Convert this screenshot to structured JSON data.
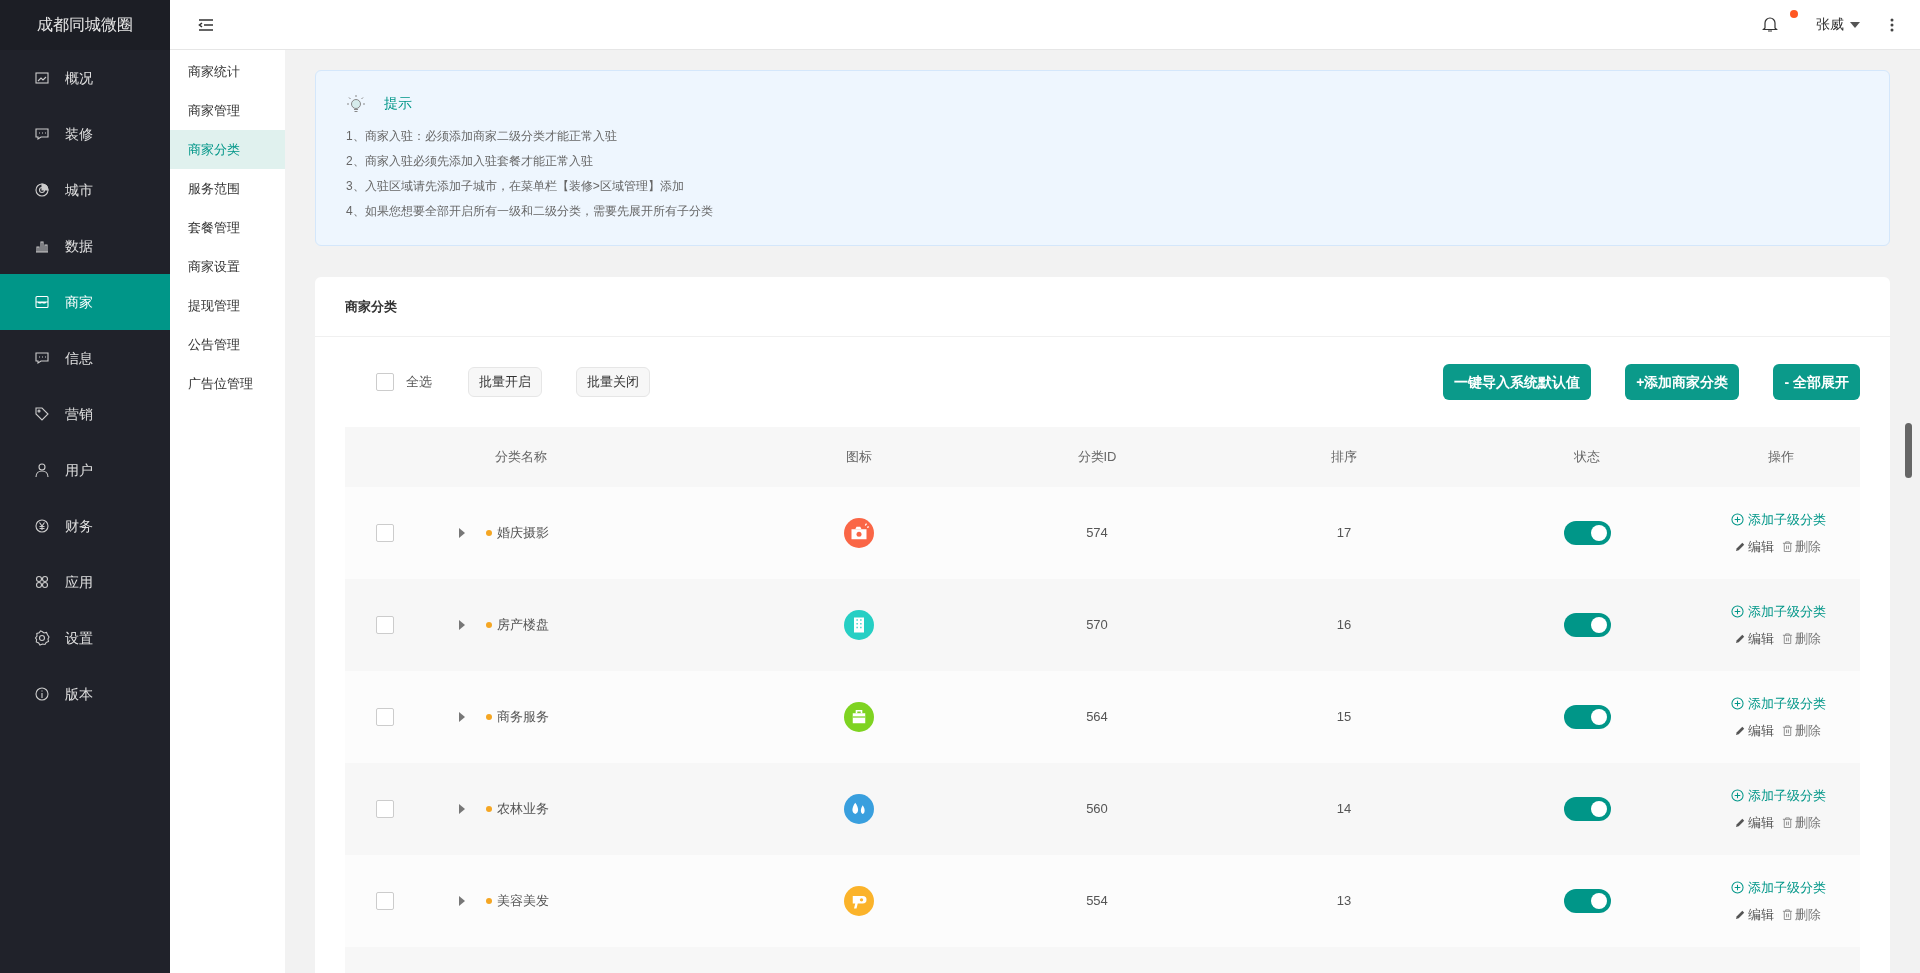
{
  "app_title": "成都同城微圈",
  "sidebar": {
    "items": [
      {
        "label": "概况",
        "selected": false
      },
      {
        "label": "装修",
        "selected": false
      },
      {
        "label": "城市",
        "selected": false
      },
      {
        "label": "数据",
        "selected": false
      },
      {
        "label": "商家",
        "selected": true
      },
      {
        "label": "信息",
        "selected": false
      },
      {
        "label": "营销",
        "selected": false
      },
      {
        "label": "用户",
        "selected": false
      },
      {
        "label": "财务",
        "selected": false
      },
      {
        "label": "应用",
        "selected": false
      },
      {
        "label": "设置",
        "selected": false
      },
      {
        "label": "版本",
        "selected": false
      }
    ]
  },
  "submenu": {
    "items": [
      {
        "label": "商家统计",
        "selected": false
      },
      {
        "label": "商家管理",
        "selected": false
      },
      {
        "label": "商家分类",
        "selected": true
      },
      {
        "label": "服务范围",
        "selected": false
      },
      {
        "label": "套餐管理",
        "selected": false
      },
      {
        "label": "商家设置",
        "selected": false
      },
      {
        "label": "提现管理",
        "selected": false
      },
      {
        "label": "公告管理",
        "selected": false
      },
      {
        "label": "广告位管理",
        "selected": false
      }
    ]
  },
  "header": {
    "user": "张威"
  },
  "tip": {
    "title": "提示",
    "lines": [
      "1、商家入驻：必须添加商家二级分类才能正常入驻",
      "2、商家入驻必须先添加入驻套餐才能正常入驻",
      "3、入驻区域请先添加子城市，在菜单栏【装修>区域管理】添加",
      "4、如果您想要全部开启所有一级和二级分类，需要先展开所有子分类"
    ]
  },
  "card": {
    "title": "商家分类",
    "toolbar": {
      "select_all": {
        "label": "全选",
        "checked": false
      },
      "batch_buttons": [
        "批量开启",
        "批量关闭"
      ],
      "action_buttons": [
        "一键导入系统默认值",
        "+添加商家分类",
        "- 全部展开"
      ]
    },
    "table": {
      "columns": [
        "分类名称",
        "图标",
        "分类ID",
        "排序",
        "状态",
        "操作"
      ],
      "rows": [
        {
          "checked": false,
          "expanded": false,
          "name": "婚庆摄影",
          "color": "#fa6646",
          "id": "574",
          "sort": "17",
          "on": true,
          "add_child": "添加子级分类",
          "edit": "编辑",
          "delete": "删除"
        },
        {
          "checked": false,
          "expanded": false,
          "name": "房产楼盘",
          "color": "#26cfc4",
          "id": "570",
          "sort": "16",
          "on": true,
          "add_child": "添加子级分类",
          "edit": "编辑",
          "delete": "删除"
        },
        {
          "checked": false,
          "expanded": false,
          "name": "商务服务",
          "color": "#7ed321",
          "id": "564",
          "sort": "15",
          "on": true,
          "add_child": "添加子级分类",
          "edit": "编辑",
          "delete": "删除"
        },
        {
          "checked": false,
          "expanded": false,
          "name": "农林业务",
          "color": "#399fde",
          "id": "560",
          "sort": "14",
          "on": true,
          "add_child": "添加子级分类",
          "edit": "编辑",
          "delete": "删除"
        },
        {
          "checked": false,
          "expanded": false,
          "name": "美容美发",
          "color": "#fbb32a",
          "id": "554",
          "sort": "13",
          "on": true,
          "add_child": "添加子级分类",
          "edit": "编辑",
          "delete": "删除"
        }
      ]
    }
  }
}
